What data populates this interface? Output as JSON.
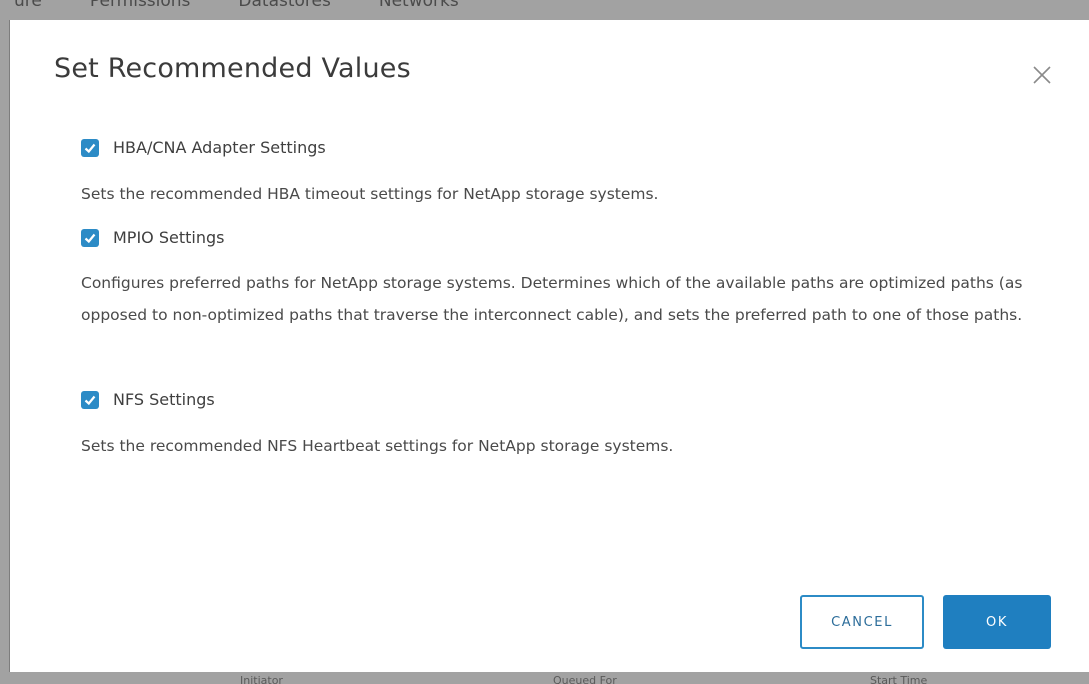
{
  "background": {
    "tabs": [
      "ure",
      "Permissions",
      "Datastores",
      "Networks"
    ],
    "bottom_fragments": [
      "Initiator",
      "Queued For",
      "Start Time"
    ]
  },
  "dialog": {
    "title": "Set Recommended Values",
    "options": [
      {
        "label": "HBA/CNA Adapter Settings",
        "checked": true,
        "description": "Sets the recommended HBA timeout settings for NetApp storage systems."
      },
      {
        "label": "MPIO Settings",
        "checked": true,
        "description": "Configures preferred paths for NetApp storage systems. Determines which of the available paths are optimized paths (as opposed to non-optimized paths that traverse the interconnect cable), and sets the preferred path to one of those paths."
      },
      {
        "label": "NFS Settings",
        "checked": true,
        "description": "Sets the recommended NFS Heartbeat settings for NetApp storage systems."
      }
    ],
    "buttons": {
      "cancel": "CANCEL",
      "ok": "OK"
    }
  },
  "colors": {
    "accent": "#2c8bc6",
    "ok_fill": "#1f7fc0",
    "backdrop": "#a2a2a2"
  },
  "icons": {
    "close": "close-icon",
    "checkbox": "checkmark-icon"
  }
}
